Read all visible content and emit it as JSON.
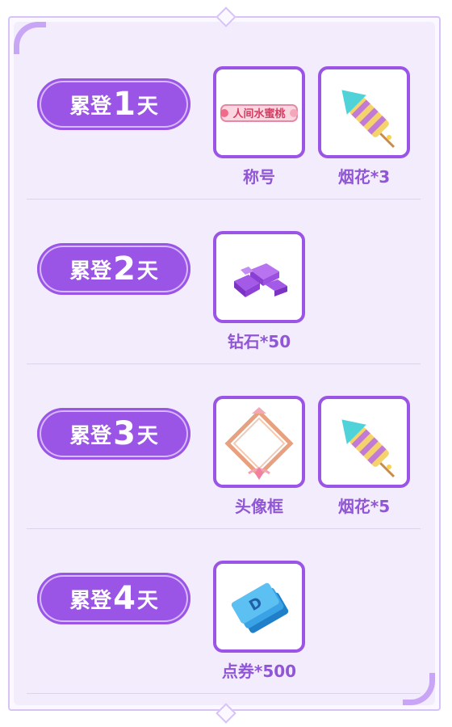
{
  "rewards": [
    {
      "day_prefix": "累登",
      "day_number": "1",
      "day_suffix": "天",
      "items": [
        {
          "label": "称号",
          "icon": "title-badge-icon",
          "badge_text": "人间水蜜桃"
        },
        {
          "label": "烟花*3",
          "icon": "firework-rocket-icon"
        }
      ]
    },
    {
      "day_prefix": "累登",
      "day_number": "2",
      "day_suffix": "天",
      "items": [
        {
          "label": "钻石*50",
          "icon": "diamond-gems-icon"
        }
      ]
    },
    {
      "day_prefix": "累登",
      "day_number": "3",
      "day_suffix": "天",
      "items": [
        {
          "label": "头像框",
          "icon": "avatar-frame-icon"
        },
        {
          "label": "烟花*5",
          "icon": "firework-rocket-icon"
        }
      ]
    },
    {
      "day_prefix": "累登",
      "day_number": "4",
      "day_suffix": "天",
      "items": [
        {
          "label": "点券*500",
          "icon": "coupon-tickets-icon"
        }
      ]
    }
  ],
  "colors": {
    "accent": "#9a55e6",
    "label": "#9056d6",
    "panel": "#f3ecfd",
    "frame": "#d7c4f6"
  }
}
